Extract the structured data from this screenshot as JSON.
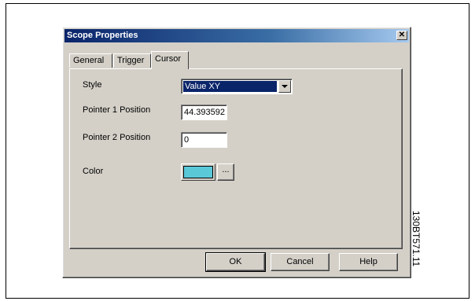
{
  "dialog": {
    "title": "Scope Properties",
    "close_symbol": "✕",
    "tabs": [
      {
        "label": "General",
        "active": false
      },
      {
        "label": "Trigger",
        "active": false
      },
      {
        "label": "Cursor",
        "active": true
      }
    ],
    "cursor_tab": {
      "style_label": "Style",
      "style_value": "Value XY",
      "pointer1_label": "Pointer 1 Position",
      "pointer1_value": "44.393592",
      "pointer2_label": "Pointer 2 Position",
      "pointer2_value": "0",
      "color_label": "Color",
      "color_value": "#5bc8d8",
      "color_button_label": "..."
    },
    "buttons": {
      "ok": "OK",
      "cancel": "Cancel",
      "help": "Help"
    }
  },
  "figure_code": "130BT571.11",
  "icons": {
    "close": "close-icon",
    "dropdown": "chevron-down-icon"
  }
}
